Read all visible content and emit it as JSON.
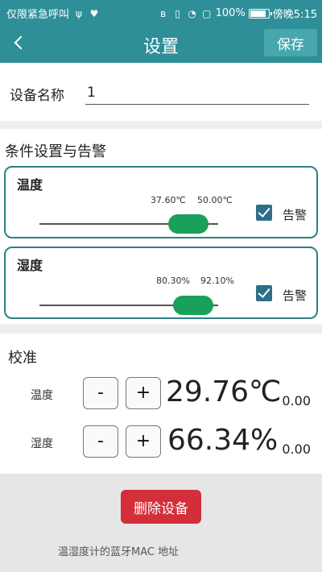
{
  "statusbar": {
    "left_text": "仅限紧急呼叫",
    "battery": "100%",
    "time": "傍晚5:15"
  },
  "appbar": {
    "title": "设置",
    "save_label": "保存"
  },
  "device": {
    "name_label": "设备名称",
    "name_value": "1"
  },
  "conditions": {
    "title": "条件设置与告警",
    "temperature": {
      "label": "温度",
      "low": "37.60℃",
      "high": "50.00℃",
      "alarm_checked": true,
      "alarm_label": "告警"
    },
    "humidity": {
      "label": "湿度",
      "low": "80.30%",
      "high": "92.10%",
      "alarm_checked": true,
      "alarm_label": "告警"
    }
  },
  "calibration": {
    "title": "校准",
    "rows": [
      {
        "label": "温度",
        "minus": "-",
        "plus": "+",
        "value": "29.76℃",
        "offset": "0.00"
      },
      {
        "label": "湿度",
        "minus": "-",
        "plus": "+",
        "value": "66.34%",
        "offset": "0.00"
      }
    ]
  },
  "footer": {
    "delete_label": "删除设备",
    "mac_text": "温湿度计的蓝牙MAC 地址"
  },
  "colors": {
    "accent": "#2e8f98",
    "slider_thumb": "#19a05a",
    "delete": "#d32f3a"
  }
}
